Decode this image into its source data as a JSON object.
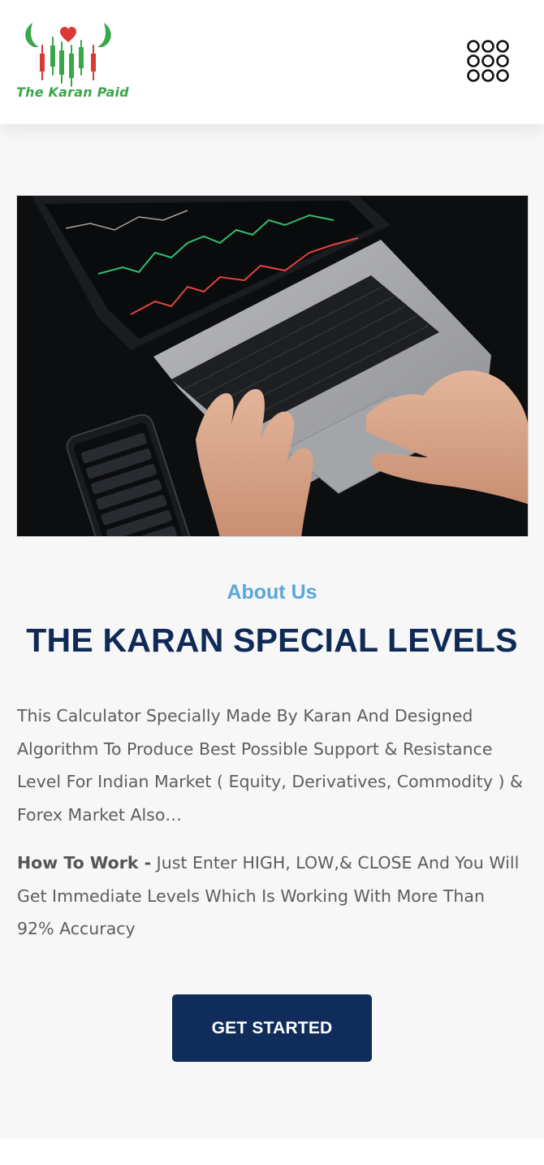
{
  "header": {
    "logo_text": "The Karan Paid",
    "logo_alt_icon": "bull-candlestick-logo",
    "menu_icon": "grid-menu-icon"
  },
  "hero": {
    "image_description": "laptop-trading-charts-photo"
  },
  "about": {
    "eyebrow": "About Us",
    "title": "THE KARAN SPECIAL LEVELS",
    "paragraph": "This Calculator Specially Made By Karan And Designed Algorithm To Produce Best Possible Support & Resistance Level For Indian Market ( Equity, Derivatives, Commodity ) & Forex Market Also…",
    "how_label": "How To Work -",
    "how_text": " Just Enter HIGH, LOW,& CLOSE And You Will Get Immediate Levels Which Is Working With More Than 92% Accuracy",
    "cta_label": "GET STARTED"
  },
  "colors": {
    "brand_navy": "#102c5a",
    "title_navy": "#0f2a57",
    "eyebrow_blue": "#5aa7d8",
    "logo_green": "#3aa64a",
    "logo_red": "#d93a34",
    "section_bg": "#f7f7f7"
  }
}
